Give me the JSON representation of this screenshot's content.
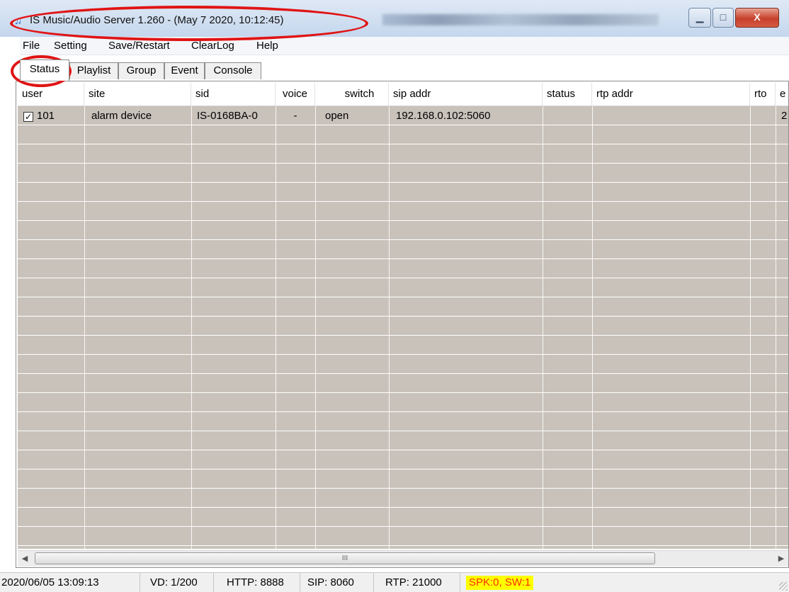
{
  "window": {
    "title": "IS Music/Audio Server 1.260 - (May  7 2020, 10:12:45)",
    "buttons": {
      "minimize": "▁",
      "maximize": "□",
      "close": "X"
    }
  },
  "menu": [
    "File",
    "Setting",
    "Save/Restart",
    "ClearLog",
    "Help"
  ],
  "tabs": [
    "Status",
    "Playlist",
    "Group",
    "Event",
    "Console"
  ],
  "active_tab": "Status",
  "table": {
    "columns": [
      "user",
      "site",
      "sid",
      "voice",
      "switch",
      "sip addr",
      "status",
      "rtp addr",
      "rto",
      "e"
    ],
    "rows": [
      {
        "checked": true,
        "check_glyph": "✓",
        "user": "101",
        "site": "alarm device",
        "sid": "IS-0168BA-0",
        "voice": "-",
        "switch": "open",
        "sip_addr": "192.168.0.102:5060",
        "status": "",
        "rtp_addr": "",
        "rto": "",
        "e": "2"
      }
    ]
  },
  "scrollbar": {
    "left_arrow": "◀",
    "right_arrow": "▶",
    "thumb_grip": "III"
  },
  "statusbar": {
    "datetime": "2020/06/05 13:09:13",
    "vd": "VD: 1/200",
    "http": "HTTP: 8888",
    "sip": "SIP: 8060",
    "rtp": "RTP: 21000",
    "spk": "SPK:0, SW:1"
  },
  "colors": {
    "grid_fill": "#c8c2ba",
    "annotation": "#e01414",
    "warn_bg": "#ffff00",
    "warn_fg": "#ff2a00",
    "app_icon": "#1c6ad6"
  },
  "icons": {
    "app": "music-note-icon",
    "app_glyph": "♫"
  }
}
